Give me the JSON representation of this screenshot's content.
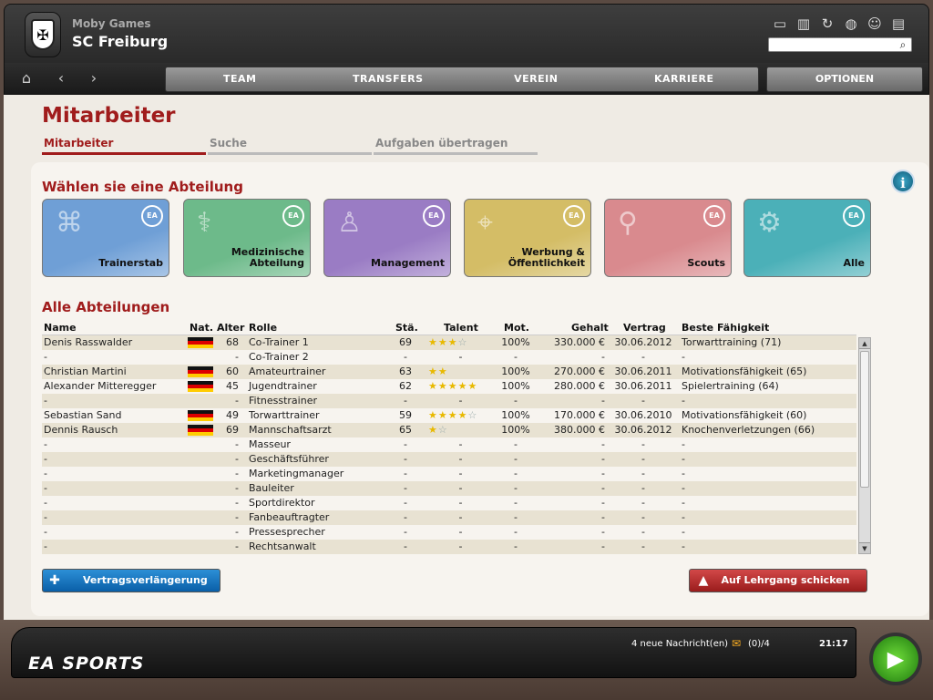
{
  "header": {
    "studio": "Moby Games",
    "club": "SC Freiburg",
    "search_placeholder": "",
    "icons": [
      "window-icon",
      "chart-icon",
      "refresh-icon",
      "globe-icon",
      "people-icon",
      "document-icon"
    ]
  },
  "nav": {
    "items": [
      "TEAM",
      "TRANSFERS",
      "VEREIN",
      "KARRIERE"
    ],
    "options": "OPTIONEN"
  },
  "page": {
    "title": "Mitarbeiter",
    "tabs": [
      "Mitarbeiter",
      "Suche",
      "Aufgaben übertragen"
    ]
  },
  "departments": {
    "title": "Wählen sie eine Abteilung",
    "items": [
      {
        "label": "Trainerstab",
        "color": "#6f9fd6"
      },
      {
        "label": "Medizinische Abteilung",
        "color": "#6dba8a"
      },
      {
        "label": "Management",
        "color": "#9a7cc4"
      },
      {
        "label": "Werbung & Öffentlichkeit",
        "color": "#d4bd66"
      },
      {
        "label": "Scouts",
        "color": "#d98a8e"
      },
      {
        "label": "Alle",
        "color": "#4bb0b8"
      }
    ]
  },
  "table": {
    "title": "Alle Abteilungen",
    "headers": {
      "name": "Name",
      "nat": "Nat.",
      "age": "Alter",
      "role": "Rolle",
      "sta": "Stä.",
      "talent": "Talent",
      "mot": "Mot.",
      "salary": "Gehalt",
      "contract": "Vertrag",
      "skill": "Beste Fähigkeit"
    },
    "rows": [
      {
        "name": "Denis Rasswalder",
        "flag": true,
        "age": "68",
        "role": "Co-Trainer 1",
        "sta": "69",
        "stars_full": 3,
        "stars_empty": 1,
        "mot": "100%",
        "salary": "330.000 €",
        "contract": "30.06.2012",
        "skill": "Torwarttraining (71)"
      },
      {
        "name": "-",
        "flag": false,
        "age": "-",
        "role": "Co-Trainer 2",
        "sta": "-",
        "stars_full": 0,
        "stars_empty": 0,
        "mot": "-",
        "salary": "-",
        "contract": "-",
        "skill": "-"
      },
      {
        "name": "Christian Martini",
        "flag": true,
        "age": "60",
        "role": "Amateurtrainer",
        "sta": "63",
        "stars_full": 2,
        "stars_empty": 0,
        "mot": "100%",
        "salary": "270.000 €",
        "contract": "30.06.2011",
        "skill": "Motivationsfähigkeit (65)"
      },
      {
        "name": "Alexander Mitteregger",
        "flag": true,
        "age": "45",
        "role": "Jugendtrainer",
        "sta": "62",
        "stars_full": 5,
        "stars_empty": 0,
        "mot": "100%",
        "salary": "280.000 €",
        "contract": "30.06.2011",
        "skill": "Spielertraining (64)"
      },
      {
        "name": "-",
        "flag": false,
        "age": "-",
        "role": "Fitnesstrainer",
        "sta": "-",
        "stars_full": 0,
        "stars_empty": 0,
        "mot": "-",
        "salary": "-",
        "contract": "-",
        "skill": "-"
      },
      {
        "name": "Sebastian Sand",
        "flag": true,
        "age": "49",
        "role": "Torwarttrainer",
        "sta": "59",
        "stars_full": 4,
        "stars_empty": 1,
        "mot": "100%",
        "salary": "170.000 €",
        "contract": "30.06.2010",
        "skill": "Motivationsfähigkeit (60)"
      },
      {
        "name": "Dennis Rausch",
        "flag": true,
        "age": "69",
        "role": "Mannschaftsarzt",
        "sta": "65",
        "stars_full": 1,
        "stars_empty": 1,
        "mot": "100%",
        "salary": "380.000 €",
        "contract": "30.06.2012",
        "skill": "Knochenverletzungen (66)"
      },
      {
        "name": "-",
        "flag": false,
        "age": "-",
        "role": "Masseur",
        "sta": "-",
        "stars_full": 0,
        "stars_empty": 0,
        "mot": "-",
        "salary": "-",
        "contract": "-",
        "skill": "-"
      },
      {
        "name": "-",
        "flag": false,
        "age": "-",
        "role": "Geschäftsführer",
        "sta": "-",
        "stars_full": 0,
        "stars_empty": 0,
        "mot": "-",
        "salary": "-",
        "contract": "-",
        "skill": "-"
      },
      {
        "name": "-",
        "flag": false,
        "age": "-",
        "role": "Marketingmanager",
        "sta": "-",
        "stars_full": 0,
        "stars_empty": 0,
        "mot": "-",
        "salary": "-",
        "contract": "-",
        "skill": "-"
      },
      {
        "name": "-",
        "flag": false,
        "age": "-",
        "role": "Bauleiter",
        "sta": "-",
        "stars_full": 0,
        "stars_empty": 0,
        "mot": "-",
        "salary": "-",
        "contract": "-",
        "skill": "-"
      },
      {
        "name": "-",
        "flag": false,
        "age": "-",
        "role": "Sportdirektor",
        "sta": "-",
        "stars_full": 0,
        "stars_empty": 0,
        "mot": "-",
        "salary": "-",
        "contract": "-",
        "skill": "-"
      },
      {
        "name": "-",
        "flag": false,
        "age": "-",
        "role": "Fanbeauftragter",
        "sta": "-",
        "stars_full": 0,
        "stars_empty": 0,
        "mot": "-",
        "salary": "-",
        "contract": "-",
        "skill": "-"
      },
      {
        "name": "-",
        "flag": false,
        "age": "-",
        "role": "Pressesprecher",
        "sta": "-",
        "stars_full": 0,
        "stars_empty": 0,
        "mot": "-",
        "salary": "-",
        "contract": "-",
        "skill": "-"
      },
      {
        "name": "-",
        "flag": false,
        "age": "-",
        "role": "Rechtsanwalt",
        "sta": "-",
        "stars_full": 0,
        "stars_empty": 0,
        "mot": "-",
        "salary": "-",
        "contract": "-",
        "skill": "-"
      }
    ]
  },
  "actions": {
    "extend": "Vertragsverlängerung",
    "course": "Auf Lehrgang schicken"
  },
  "footer": {
    "brand": "EA SPORTS",
    "messages": "4 neue Nachricht(en)",
    "msg_count": "(0)/4",
    "time": "21:17"
  }
}
